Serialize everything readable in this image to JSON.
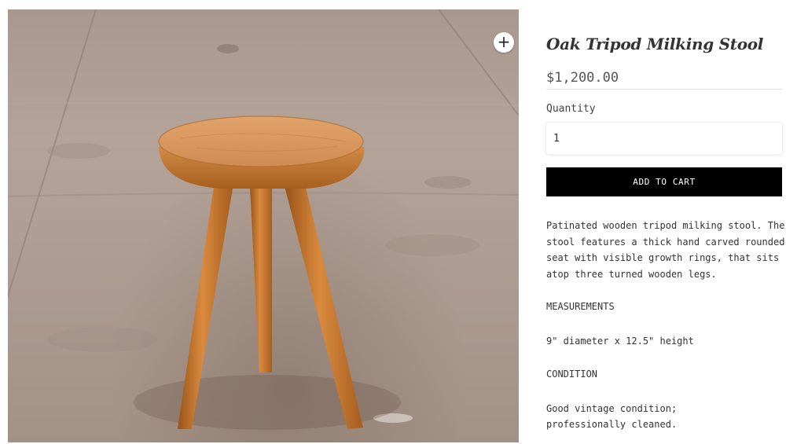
{
  "product": {
    "title": "Oak Tripod Milking Stool",
    "price": "$1,200.00",
    "image_alt": "Oak tripod milking stool on concrete floor"
  },
  "gallery": {
    "zoom_icon": "plus-icon",
    "zoom_glyph": "+"
  },
  "quantity": {
    "label": "Quantity",
    "value": "1"
  },
  "cart": {
    "add_label": "ADD TO CART"
  },
  "description": {
    "lines": [
      "Patinated wooden tripod milking stool. The",
      "stool features a thick hand carved rounded",
      "seat with visible growth rings, that sits",
      "atop three turned wooden legs."
    ],
    "measurements_heading": "MEASUREMENTS",
    "measurements_value": "9\" diameter x 12.5\" height",
    "condition_heading": "CONDITION",
    "condition_lines": [
      "Good vintage condition;",
      "professionally cleaned."
    ]
  },
  "colors": {
    "button_bg": "#000000",
    "button_text": "#ffffff",
    "wood": "#c8742f",
    "floor": "#ad9c91"
  }
}
